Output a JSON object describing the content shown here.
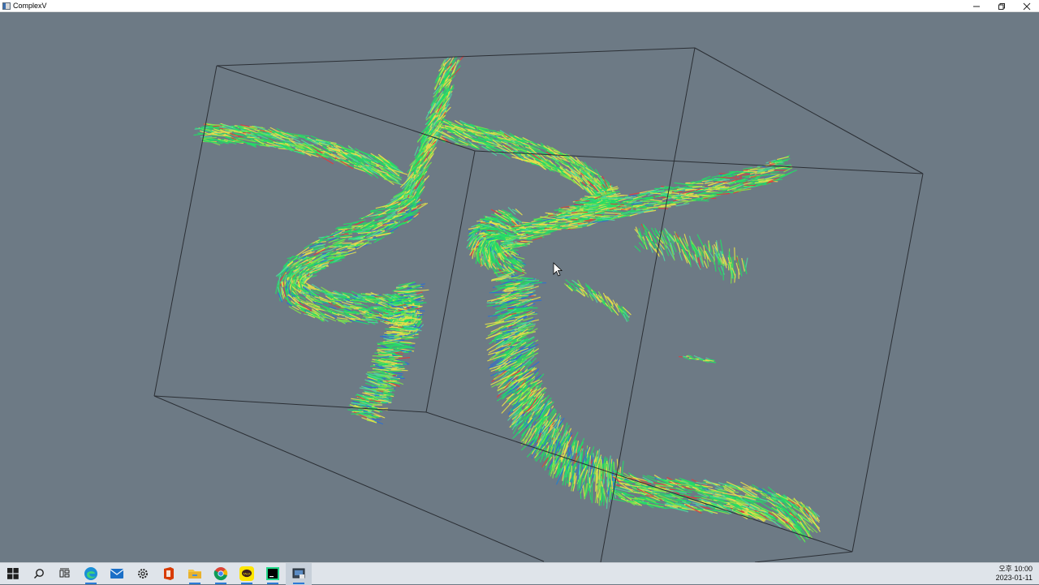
{
  "window": {
    "title": "ComplexV",
    "controls": [
      "minimize",
      "restore",
      "close"
    ]
  },
  "viewport": {
    "background_color": "#6d7a85",
    "bounding_box_color": "#2b2f35",
    "description_colors": {
      "low": "#2b6fd6",
      "mid": "#22dd66",
      "high": "#e8e04a",
      "peak": "#e23b3b"
    }
  },
  "taskbar": {
    "items": [
      {
        "name": "start-icon",
        "active": false
      },
      {
        "name": "search-icon",
        "active": false
      },
      {
        "name": "task-view-icon",
        "active": false
      },
      {
        "name": "edge-icon",
        "active": true
      },
      {
        "name": "mail-icon",
        "active": false
      },
      {
        "name": "settings-icon",
        "active": false
      },
      {
        "name": "office-icon",
        "active": false
      },
      {
        "name": "file-explorer-icon",
        "active": true
      },
      {
        "name": "chrome-icon",
        "active": true
      },
      {
        "name": "kakaotalk-icon",
        "active": true
      },
      {
        "name": "pycharm-icon",
        "active": true
      },
      {
        "name": "complexv-app-icon",
        "active": true
      }
    ],
    "clock_time": "오후 10:00",
    "clock_date": "2023-01-11"
  }
}
